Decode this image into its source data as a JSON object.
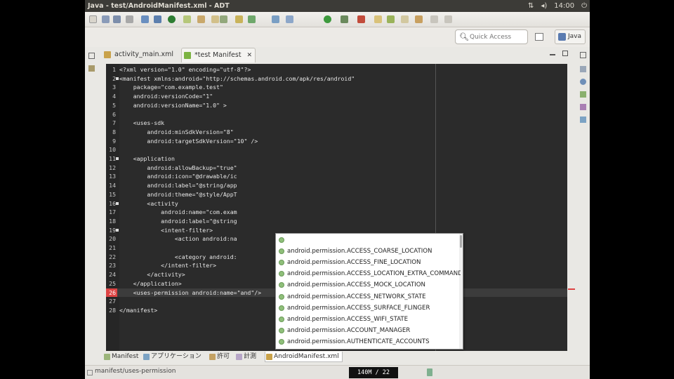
{
  "window_title": "Java - test/AndroidManifest.xml - ADT",
  "panel": {
    "keyboard": "⇅",
    "volume": "◂)",
    "clock": "14:00",
    "power": "⏻"
  },
  "search": {
    "placeholder": "Quick Access"
  },
  "perspective": {
    "label": "Java"
  },
  "tabs": [
    {
      "label": "activity_main.xml",
      "active": false
    },
    {
      "label": "*test Manifest",
      "active": true
    }
  ],
  "editor": {
    "lines": [
      {
        "num": "1",
        "code": "<?xml version=\"1.0\" encoding=\"utf-8\"?>"
      },
      {
        "num": "2",
        "code": "<manifest xmlns:android=\"http://schemas.android.com/apk/res/android\"",
        "fold": true
      },
      {
        "num": "3",
        "code": "    package=\"com.example.test\""
      },
      {
        "num": "4",
        "code": "    android:versionCode=\"1\""
      },
      {
        "num": "5",
        "code": "    android:versionName=\"1.0\" >"
      },
      {
        "num": "6",
        "code": ""
      },
      {
        "num": "7",
        "code": "    <uses-sdk"
      },
      {
        "num": "8",
        "code": "        android:minSdkVersion=\"8\""
      },
      {
        "num": "9",
        "code": "        android:targetSdkVersion=\"10\" />"
      },
      {
        "num": "10",
        "code": ""
      },
      {
        "num": "11",
        "code": "    <application",
        "fold": true
      },
      {
        "num": "12",
        "code": "        android:allowBackup=\"true\""
      },
      {
        "num": "13",
        "code": "        android:icon=\"@drawable/ic"
      },
      {
        "num": "14",
        "code": "        android:label=\"@string/app"
      },
      {
        "num": "15",
        "code": "        android:theme=\"@style/AppT"
      },
      {
        "num": "16",
        "code": "        <activity",
        "fold": true
      },
      {
        "num": "17",
        "code": "            android:name=\"com.exam"
      },
      {
        "num": "18",
        "code": "            android:label=\"@string"
      },
      {
        "num": "19",
        "code": "            <intent-filter>",
        "fold": true
      },
      {
        "num": "20",
        "code": "                <action android:na"
      },
      {
        "num": "21",
        "code": ""
      },
      {
        "num": "22",
        "code": "                <category android:"
      },
      {
        "num": "23",
        "code": "            </intent-filter>"
      },
      {
        "num": "24",
        "code": "        </activity>"
      },
      {
        "num": "25",
        "code": "    </application>"
      },
      {
        "num": "26",
        "code": "    <uses-permission android:name=\"and\"/>",
        "current": true
      },
      {
        "num": "27",
        "code": ""
      },
      {
        "num": "28",
        "code": "</manifest>"
      }
    ]
  },
  "content_assist": {
    "items": [
      "",
      "android.permission.ACCESS_COARSE_LOCATION",
      "android.permission.ACCESS_FINE_LOCATION",
      "android.permission.ACCESS_LOCATION_EXTRA_COMMANDS",
      "android.permission.ACCESS_MOCK_LOCATION",
      "android.permission.ACCESS_NETWORK_STATE",
      "android.permission.ACCESS_SURFACE_FLINGER",
      "android.permission.ACCESS_WIFI_STATE",
      "android.permission.ACCOUNT_MANAGER",
      "android.permission.AUTHENTICATE_ACCOUNTS"
    ]
  },
  "bottom_tabs": [
    {
      "label": "Manifest"
    },
    {
      "label": "アプリケーション"
    },
    {
      "label": "許可"
    },
    {
      "label": "計測"
    },
    {
      "label": "AndroidManifest.xml",
      "active": true
    }
  ],
  "status": {
    "path": "manifest/uses-permission",
    "heap": "140M / 22"
  },
  "colors": {
    "editor_bg": "#2b2b2b",
    "current_line_marker": "#dd4444",
    "panel_bg": "#3c3b37"
  }
}
